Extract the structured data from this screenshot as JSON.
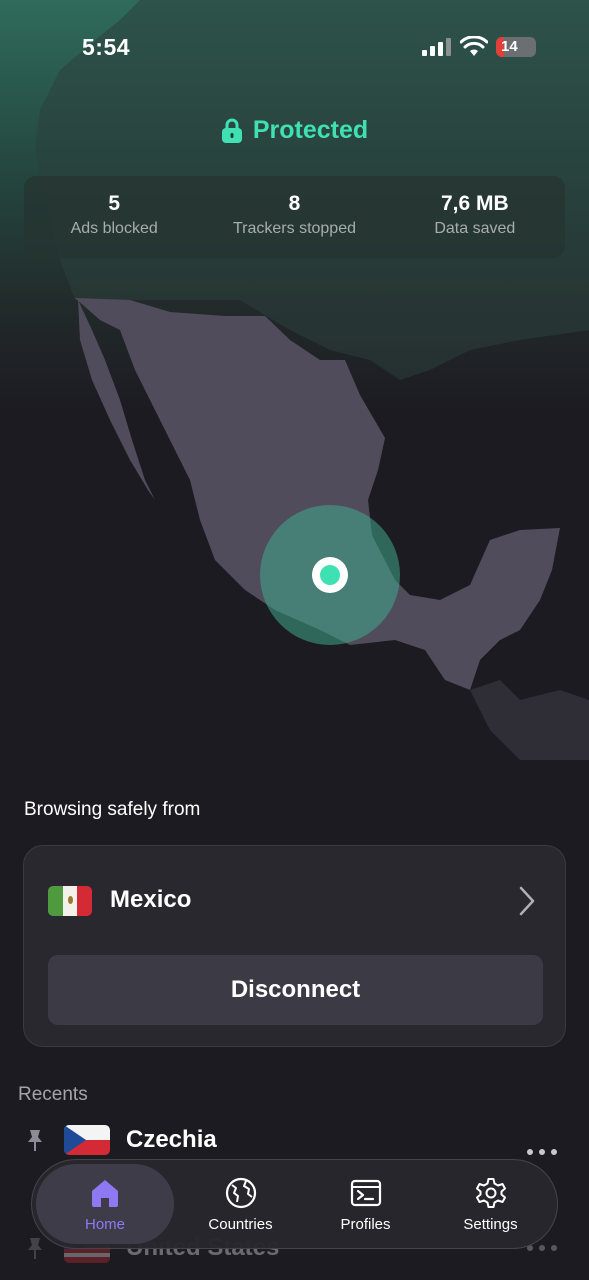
{
  "status_bar": {
    "time": "5:54",
    "battery": "14"
  },
  "protection": {
    "status": "Protected",
    "accent_color": "#3fe0b2"
  },
  "stats": [
    {
      "value": "5",
      "label": "Ads blocked"
    },
    {
      "value": "8",
      "label": "Trackers stopped"
    },
    {
      "value": "7,6 MB",
      "label": "Data saved"
    }
  ],
  "connection": {
    "heading": "Browsing safely from",
    "country": "Mexico",
    "disconnect_label": "Disconnect"
  },
  "recents": {
    "heading": "Recents",
    "items": [
      {
        "name": "Czechia"
      },
      {
        "name": "United States"
      }
    ]
  },
  "tabs": [
    {
      "label": "Home",
      "icon": "home-icon",
      "active": true
    },
    {
      "label": "Countries",
      "icon": "globe-icon",
      "active": false
    },
    {
      "label": "Profiles",
      "icon": "terminal-icon",
      "active": false
    },
    {
      "label": "Settings",
      "icon": "gear-icon",
      "active": false
    }
  ]
}
